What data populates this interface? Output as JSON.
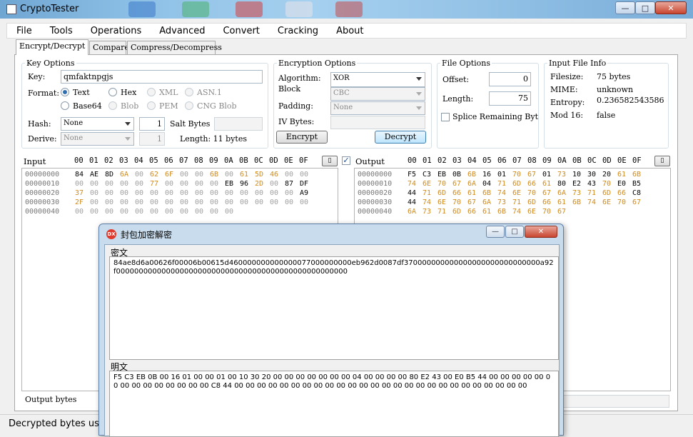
{
  "window": {
    "title": "CryptoTester",
    "controls": {
      "minimize": "—",
      "maximize": "□",
      "close": "✕"
    }
  },
  "menu": [
    "File",
    "Tools",
    "Operations",
    "Advanced",
    "Convert",
    "Cracking",
    "About"
  ],
  "tabs": [
    "Encrypt/Decrypt",
    "Compare",
    "Compress/Decompress"
  ],
  "key_options": {
    "legend": "Key Options",
    "key_label": "Key:",
    "key_value": "qmfaktnpgjs",
    "format_label": "Format:",
    "formats": [
      "Text",
      "Hex",
      "XML",
      "ASN.1",
      "Base64",
      "Blob",
      "PEM",
      "CNG Blob"
    ],
    "selected_format": "Text",
    "hash_label": "Hash:",
    "hash_value": "None",
    "hash_count": "1",
    "salt_label": "Salt Bytes",
    "derive_label": "Derive:",
    "derive_value": "None",
    "derive_count": "1",
    "length_text": "Length: 11 bytes"
  },
  "encryption_options": {
    "legend": "Encryption Options",
    "algorithm_label": "Algorithm:",
    "algorithm_value": "XOR",
    "block_label": "Block",
    "block_value": "CBC",
    "padding_label": "Padding:",
    "padding_value": "None",
    "iv_label": "IV Bytes:",
    "encrypt_label": "Encrypt",
    "decrypt_label": "Decrypt"
  },
  "file_options": {
    "legend": "File Options",
    "offset_label": "Offset:",
    "offset_value": "0",
    "length_label": "Length:",
    "length_value": "75",
    "splice_label": "Splice Remaining Byt"
  },
  "input_file_info": {
    "legend": "Input File Info",
    "rows": [
      {
        "label": "Filesize:",
        "value": "75 bytes"
      },
      {
        "label": "MIME:",
        "value": "unknown"
      },
      {
        "label": "Entropy:",
        "value": "0.236582543586"
      },
      {
        "label": "Mod 16:",
        "value": "false"
      }
    ]
  },
  "input_panel": {
    "title": "Input",
    "columns": [
      "00",
      "01",
      "02",
      "03",
      "04",
      "05",
      "06",
      "07",
      "08",
      "09",
      "0A",
      "0B",
      "0C",
      "0D",
      "0E",
      "0F"
    ],
    "rows": [
      {
        "offset": "00000000",
        "bytes": [
          "84",
          "AE",
          "8D",
          "6A",
          "00",
          "62",
          "6F",
          "00",
          "00",
          "6B",
          "00",
          "61",
          "5D",
          "46",
          "00",
          "00"
        ]
      },
      {
        "offset": "00000010",
        "bytes": [
          "00",
          "00",
          "00",
          "00",
          "00",
          "77",
          "00",
          "00",
          "00",
          "00",
          "EB",
          "96",
          "2D",
          "00",
          "87",
          "DF"
        ]
      },
      {
        "offset": "00000020",
        "bytes": [
          "37",
          "00",
          "00",
          "00",
          "00",
          "00",
          "00",
          "00",
          "00",
          "00",
          "00",
          "00",
          "00",
          "00",
          "00",
          "A9"
        ]
      },
      {
        "offset": "00000030",
        "bytes": [
          "2F",
          "00",
          "00",
          "00",
          "00",
          "00",
          "00",
          "00",
          "00",
          "00",
          "00",
          "00",
          "00",
          "00",
          "00",
          "00"
        ]
      },
      {
        "offset": "00000040",
        "bytes": [
          "00",
          "00",
          "00",
          "00",
          "00",
          "00",
          "00",
          "00",
          "00",
          "00",
          "00"
        ]
      }
    ],
    "footer": "Output bytes"
  },
  "output_panel": {
    "title": "Output",
    "columns": [
      "00",
      "01",
      "02",
      "03",
      "04",
      "05",
      "06",
      "07",
      "08",
      "09",
      "0A",
      "0B",
      "0C",
      "0D",
      "0E",
      "0F"
    ],
    "rows": [
      {
        "offset": "00000000",
        "bytes": [
          "F5",
          "C3",
          "EB",
          "0B",
          "6B",
          "16",
          "01",
          "70",
          "67",
          "01",
          "73",
          "10",
          "30",
          "20",
          "61",
          "6B"
        ]
      },
      {
        "offset": "00000010",
        "bytes": [
          "74",
          "6E",
          "70",
          "67",
          "6A",
          "04",
          "71",
          "6D",
          "66",
          "61",
          "80",
          "E2",
          "43",
          "70",
          "E0",
          "B5"
        ]
      },
      {
        "offset": "00000020",
        "bytes": [
          "44",
          "71",
          "6D",
          "66",
          "61",
          "6B",
          "74",
          "6E",
          "70",
          "67",
          "6A",
          "73",
          "71",
          "6D",
          "66",
          "C8"
        ]
      },
      {
        "offset": "00000030",
        "bytes": [
          "44",
          "74",
          "6E",
          "70",
          "67",
          "6A",
          "73",
          "71",
          "6D",
          "66",
          "61",
          "6B",
          "74",
          "6E",
          "70",
          "67"
        ]
      },
      {
        "offset": "00000040",
        "bytes": [
          "6A",
          "73",
          "71",
          "6D",
          "66",
          "61",
          "6B",
          "74",
          "6E",
          "70",
          "67"
        ]
      }
    ]
  },
  "status": {
    "text": "Decrypted bytes using"
  },
  "dialog": {
    "title": "封包加密解密",
    "cipher_label": "密文",
    "cipher_text": "84ae8d6a00626f00006b00615d460000000000000077000000000eb962d0087df370000000000000000000000000000a92f000000000000000000000000000000000000000000000000000",
    "plain_label": "明文",
    "plain_text": "F5 C3 EB 0B 00 16 01 00 00 01 00 10 30 20 00 00 00 00 00 00 00 04 00 00 00 00 80 E2 43 00 E0 B5 44 00 00 00 00 00 00 00 00 00 00 00 00 00 00 C8 44 00 00 00 00 00 00 00 00 00 00 00 00 00 00 00 00 00 00 00 00 00 00 00 00 00 00"
  },
  "colors": {
    "highlight_byte": "#d08a1a",
    "zero_byte": "#a0a0a0",
    "titlebar": "#8dc0e6"
  }
}
